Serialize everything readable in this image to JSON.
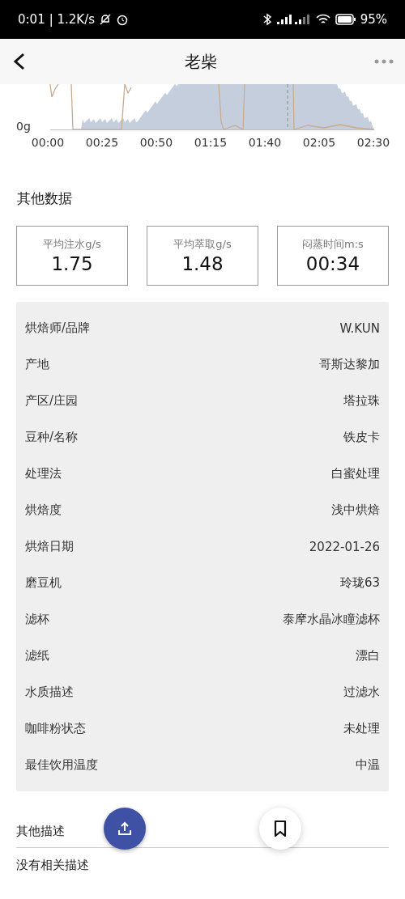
{
  "status_bar": {
    "time": "0:01",
    "speed": "| 1.2K/s",
    "battery": "95%"
  },
  "header": {
    "title": "老柴"
  },
  "chart": {
    "y_label": "0g",
    "x_labels": [
      "00:00",
      "00:25",
      "00:50",
      "01:15",
      "01:40",
      "02:05",
      "02:30"
    ]
  },
  "other_data": {
    "title": "其他数据",
    "stats": [
      {
        "label": "平均注水g/s",
        "value": "1.75"
      },
      {
        "label": "平均萃取g/s",
        "value": "1.48"
      },
      {
        "label": "闷蒸时间m:s",
        "value": "00:34"
      }
    ]
  },
  "details": [
    {
      "label": "烘焙师/品牌",
      "value": "W.KUN"
    },
    {
      "label": "产地",
      "value": "哥斯达黎加"
    },
    {
      "label": "产区/庄园",
      "value": "塔拉珠"
    },
    {
      "label": "豆种/名称",
      "value": "铁皮卡"
    },
    {
      "label": "处理法",
      "value": "白蜜处理"
    },
    {
      "label": "烘焙度",
      "value": "浅中烘焙"
    },
    {
      "label": "烘焙日期",
      "value": "2022-01-26"
    },
    {
      "label": "磨豆机",
      "value": "玲珑63"
    },
    {
      "label": "滤杯",
      "value": "泰摩水晶冰瞳滤杯"
    },
    {
      "label": "滤纸",
      "value": "漂白"
    },
    {
      "label": "水质描述",
      "value": "过滤水"
    },
    {
      "label": "咖啡粉状态",
      "value": "未处理"
    },
    {
      "label": "最佳饮用温度",
      "value": "中温"
    }
  ],
  "description": {
    "title": "其他描述",
    "text": "没有相关描述"
  }
}
